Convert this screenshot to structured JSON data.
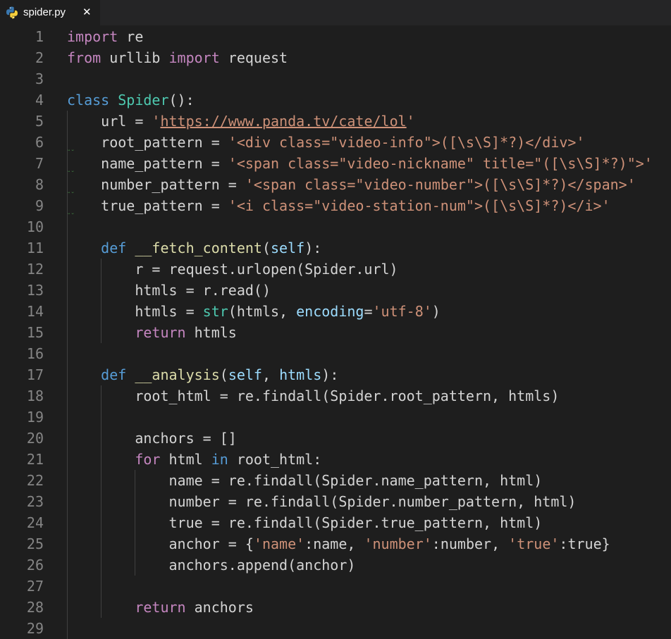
{
  "tab": {
    "filename": "spider.py",
    "close_glyph": "✕",
    "icon": "python-icon"
  },
  "editor": {
    "line_numbers": [
      "1",
      "2",
      "3",
      "4",
      "5",
      "6",
      "7",
      "8",
      "9",
      "10",
      "11",
      "12",
      "13",
      "14",
      "15",
      "16",
      "17",
      "18",
      "19",
      "20",
      "21",
      "22",
      "23",
      "24",
      "25",
      "26",
      "27",
      "28",
      "29"
    ],
    "lines": [
      [
        {
          "t": "import",
          "c": "kw"
        },
        {
          "t": " re",
          "c": ""
        }
      ],
      [
        {
          "t": "from",
          "c": "kw"
        },
        {
          "t": " urllib ",
          "c": ""
        },
        {
          "t": "import",
          "c": "kw"
        },
        {
          "t": " request",
          "c": ""
        }
      ],
      [],
      [
        {
          "t": "class",
          "c": "kwb"
        },
        {
          "t": " ",
          "c": ""
        },
        {
          "t": "Spider",
          "c": "cls"
        },
        {
          "t": "():",
          "c": ""
        }
      ],
      [
        {
          "t": "    url = ",
          "c": ""
        },
        {
          "t": "'",
          "c": "str"
        },
        {
          "t": "https://www.panda.tv/cate/lol",
          "c": "str link"
        },
        {
          "t": "'",
          "c": "str"
        }
      ],
      [
        {
          "t": "    root_pattern = ",
          "c": ""
        },
        {
          "t": "'<div class=\"video-info\">([\\s\\S]*?)</div>'",
          "c": "str"
        }
      ],
      [
        {
          "t": "    name_pattern = ",
          "c": ""
        },
        {
          "t": "'<span class=\"video-nickname\" title=\"([\\s\\S]*?)\">'",
          "c": "str"
        }
      ],
      [
        {
          "t": "    number_pattern = ",
          "c": ""
        },
        {
          "t": "'<span class=\"video-number\">([\\s\\S]*?)</span>'",
          "c": "str"
        }
      ],
      [
        {
          "t": "    true_pattern = ",
          "c": ""
        },
        {
          "t": "'<i class=\"video-station-num\">([\\s\\S]*?)</i>'",
          "c": "str"
        }
      ],
      [],
      [
        {
          "t": "    ",
          "c": ""
        },
        {
          "t": "def",
          "c": "kwb"
        },
        {
          "t": " ",
          "c": ""
        },
        {
          "t": "__fetch_content",
          "c": "fn"
        },
        {
          "t": "(",
          "c": ""
        },
        {
          "t": "self",
          "c": "prm"
        },
        {
          "t": "):",
          "c": ""
        }
      ],
      [
        {
          "t": "        r = request.urlopen(Spider.url)",
          "c": ""
        }
      ],
      [
        {
          "t": "        htmls = r.read()",
          "c": ""
        }
      ],
      [
        {
          "t": "        htmls = ",
          "c": ""
        },
        {
          "t": "str",
          "c": "cls"
        },
        {
          "t": "(htmls, ",
          "c": ""
        },
        {
          "t": "encoding",
          "c": "prm"
        },
        {
          "t": "=",
          "c": ""
        },
        {
          "t": "'utf-8'",
          "c": "str"
        },
        {
          "t": ")",
          "c": ""
        }
      ],
      [
        {
          "t": "        ",
          "c": ""
        },
        {
          "t": "return",
          "c": "kw"
        },
        {
          "t": " htmls",
          "c": ""
        }
      ],
      [],
      [
        {
          "t": "    ",
          "c": ""
        },
        {
          "t": "def",
          "c": "kwb"
        },
        {
          "t": " ",
          "c": ""
        },
        {
          "t": "__analysis",
          "c": "fn"
        },
        {
          "t": "(",
          "c": ""
        },
        {
          "t": "self",
          "c": "prm"
        },
        {
          "t": ", ",
          "c": ""
        },
        {
          "t": "htmls",
          "c": "prm"
        },
        {
          "t": "):",
          "c": ""
        }
      ],
      [
        {
          "t": "        root_html = re.findall(Spider.root_pattern, htmls)",
          "c": ""
        }
      ],
      [],
      [
        {
          "t": "        anchors = []",
          "c": ""
        }
      ],
      [
        {
          "t": "        ",
          "c": ""
        },
        {
          "t": "for",
          "c": "kw"
        },
        {
          "t": " html ",
          "c": ""
        },
        {
          "t": "in",
          "c": "kwb"
        },
        {
          "t": " root_html:",
          "c": ""
        }
      ],
      [
        {
          "t": "            name = re.findall(Spider.name_pattern, html)",
          "c": ""
        }
      ],
      [
        {
          "t": "            number = re.findall(Spider.number_pattern, html)",
          "c": ""
        }
      ],
      [
        {
          "t": "            true = re.findall(Spider.true_pattern, html)",
          "c": ""
        }
      ],
      [
        {
          "t": "            anchor = {",
          "c": ""
        },
        {
          "t": "'name'",
          "c": "str"
        },
        {
          "t": ":name, ",
          "c": ""
        },
        {
          "t": "'number'",
          "c": "str"
        },
        {
          "t": ":number, ",
          "c": ""
        },
        {
          "t": "'true'",
          "c": "str"
        },
        {
          "t": ":true}",
          "c": ""
        }
      ],
      [
        {
          "t": "            anchors.append(anchor)",
          "c": ""
        }
      ],
      [],
      [
        {
          "t": "        ",
          "c": ""
        },
        {
          "t": "return",
          "c": "kw"
        },
        {
          "t": " anchors",
          "c": ""
        }
      ],
      []
    ],
    "squiggle_glyph": "ᵕᵕ"
  }
}
